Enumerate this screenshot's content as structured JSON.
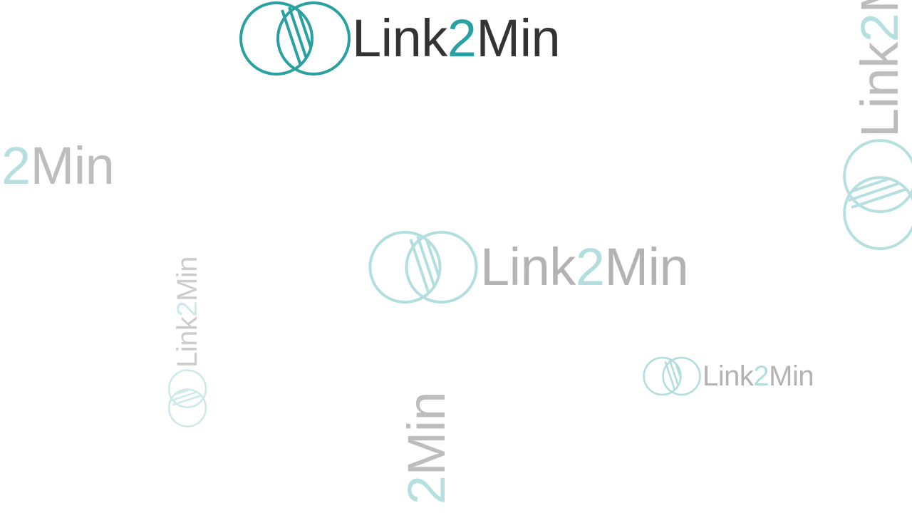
{
  "brand": {
    "prefix": "Link",
    "number": "2",
    "suffix": "Min",
    "colors": {
      "primary_teal": "#2aa1a1",
      "dark_text": "#333333",
      "faint_teal": "#b6e0e0",
      "faint_gray": "#bdbdbd"
    }
  },
  "icons": {
    "logo_mark": "two-overlapping-circles-hatched-icon"
  }
}
